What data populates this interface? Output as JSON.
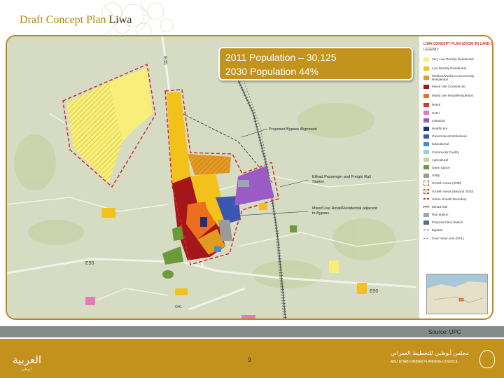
{
  "slide": {
    "title_main": "Draft Concept Plan",
    "title_sub": "Liwa"
  },
  "population": {
    "line1": "2011 Population – 30,125",
    "line2": "2030 Population 44%"
  },
  "map_labels": {
    "bypass": "Proposed Bypass Alignment",
    "rail_station": "Etihad Passenger and Freight Rail Station",
    "mixed_use": "Mixed Use Retail/Residential adjacent to Bypass",
    "route_e45": "E45",
    "route_e90_west": "E90",
    "route_e90_east": "E90",
    "ohl": "OHL"
  },
  "legend": {
    "title": "LIWA CONCEPT PLAN (ZOOM IN) LAND USE",
    "heading": "LEGEND:",
    "items": [
      {
        "label": "Very Low Density Residential",
        "color": "#f7ef7a",
        "kind": "fill"
      },
      {
        "label": "Low Density Residential",
        "color": "#f2c21b",
        "kind": "fill"
      },
      {
        "label": "Medium/Medium Low Density Residential",
        "color": "#e39a21",
        "kind": "fill"
      },
      {
        "label": "Mixed Use Commercial",
        "color": "#a4161a",
        "kind": "fill"
      },
      {
        "label": "Mixed Use Retail/Residential",
        "color": "#ec6f1e",
        "kind": "fill"
      },
      {
        "label": "Retail",
        "color": "#e03030",
        "kind": "fill"
      },
      {
        "label": "Hotel",
        "color": "#e879b8",
        "kind": "fill"
      },
      {
        "label": "Industrial",
        "color": "#9a5cc4",
        "kind": "fill"
      },
      {
        "label": "Healthcare",
        "color": "#1f2f78",
        "kind": "fill"
      },
      {
        "label": "Governance/Institutional",
        "color": "#3a56b0",
        "kind": "fill"
      },
      {
        "label": "Educational",
        "color": "#3e8fd0",
        "kind": "fill"
      },
      {
        "label": "Community Facility",
        "color": "#8fd3e3",
        "kind": "fill"
      },
      {
        "label": "Agricultural",
        "color": "#c5d58e",
        "kind": "fill"
      },
      {
        "label": "Open Space",
        "color": "#6b9a3a",
        "kind": "fill"
      },
      {
        "label": "Utility",
        "color": "#9a9a9a",
        "kind": "fill"
      },
      {
        "label": "Growth Areas (2030)",
        "color": "#c0392b",
        "kind": "dash"
      },
      {
        "label": "Growth Areas (Beyond 2030)",
        "color": "#e3a02a",
        "kind": "hatch"
      },
      {
        "label": "Urban Growth Boundary",
        "color": "#d62828",
        "kind": "line-red"
      },
      {
        "label": "Etihad Rail",
        "color": "#555555",
        "kind": "line-rail"
      },
      {
        "label": "Rail Station",
        "color": "#9ba6b0",
        "kind": "fill"
      },
      {
        "label": "Proposed Bus Station",
        "color": "#5a6b8a",
        "kind": "fill"
      },
      {
        "label": "Bypass",
        "color": "#444444",
        "kind": "line-dash"
      },
      {
        "label": "Over Head Line (OHL)",
        "color": "#666666",
        "kind": "line-dot"
      }
    ]
  },
  "source": "Source: UPC",
  "page_number": "9",
  "footer": {
    "left_logo": "العربية",
    "left_logo_sub": "أبوظبي",
    "right_org_ar": "مجلس أبوظبي للتخطيط العمراني",
    "right_org_en": "ABU DHABI URBAN PLANNING COUNCIL"
  },
  "colors": {
    "accent_gold": "#c3921c",
    "title_gold": "#b8860b",
    "footer_bar": "#858b88"
  }
}
